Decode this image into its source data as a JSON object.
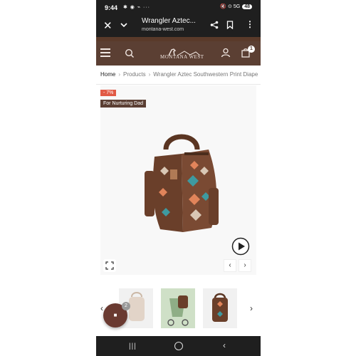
{
  "status_bar": {
    "time": "9:44",
    "left_icons": "✱ ◉ ⌁ ···",
    "right_icons": "🔇 ⊙ 5G",
    "battery": "48"
  },
  "browser": {
    "title": "Wrangler Aztec...",
    "url": "montana-west.com",
    "close_icon": "close-icon",
    "more_label": "⋮"
  },
  "site_header": {
    "logo_text": "MONTANA WEST",
    "cart_count": "1"
  },
  "breadcrumb": {
    "home": "Home",
    "products": "Products",
    "current": "Wrangler Aztec Southwestern Print Diape"
  },
  "product": {
    "sale_badge": "- 7%",
    "promo_badge": "For Nurturing Dad",
    "prev_arrow": "‹",
    "next_arrow": "›"
  },
  "thumbs": {
    "prev": "‹",
    "next": "›",
    "fab_label": "■",
    "fab_count": "2"
  },
  "colors": {
    "brand_brown": "#5b3f33",
    "sale_red": "#e15a45",
    "bag_brown": "#6a3f2a"
  }
}
